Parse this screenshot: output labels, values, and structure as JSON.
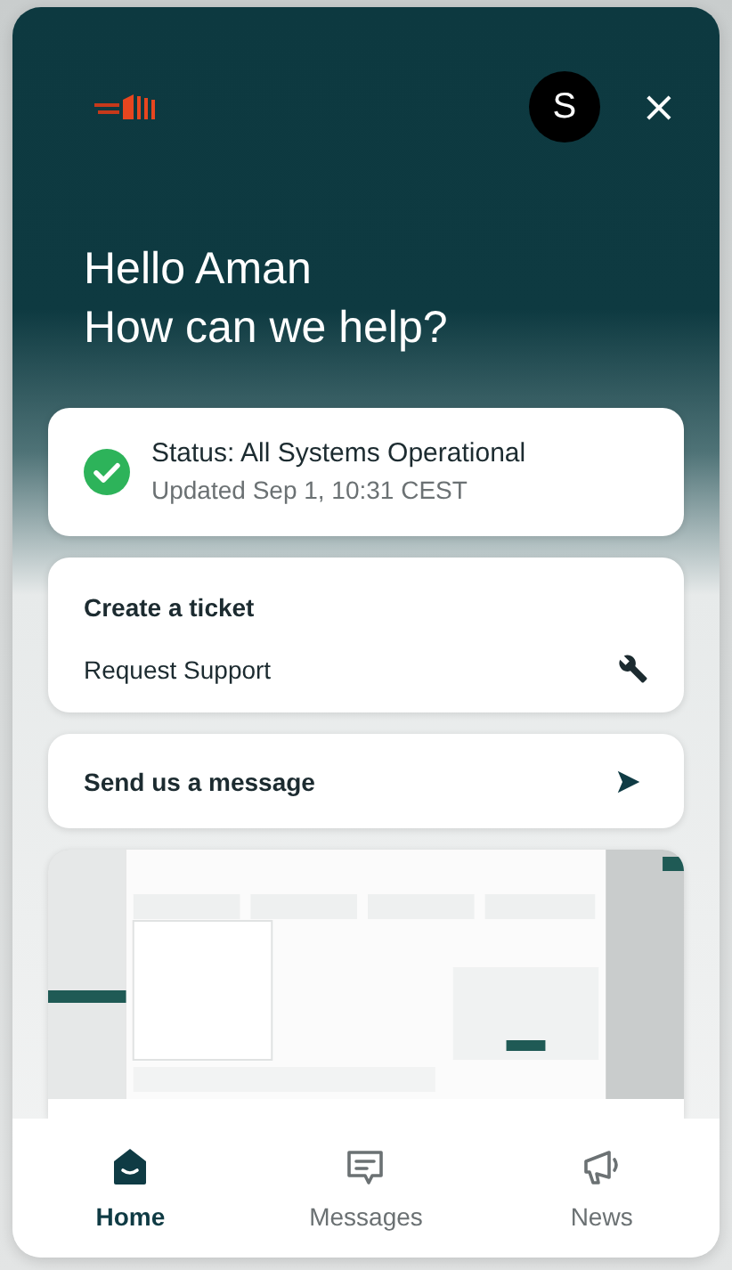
{
  "header": {
    "avatar": "S",
    "close": "×"
  },
  "greeting": [
    "Hello Aman",
    "How can we help?"
  ],
  "status": {
    "ok": true,
    "title": "Status: All Systems Operational",
    "updated": "Updated Sep 1, 10:31 CEST"
  },
  "ticket": {
    "title": "Create a ticket",
    "action": "Request Support"
  },
  "message": {
    "label": "Send us a message"
  },
  "preview": {
    "kind": "picture"
  },
  "nav": [
    {
      "label": "Home",
      "selected": true
    },
    {
      "label": "Messages",
      "selected": false
    },
    {
      "label": "News",
      "selected": false
    }
  ]
}
